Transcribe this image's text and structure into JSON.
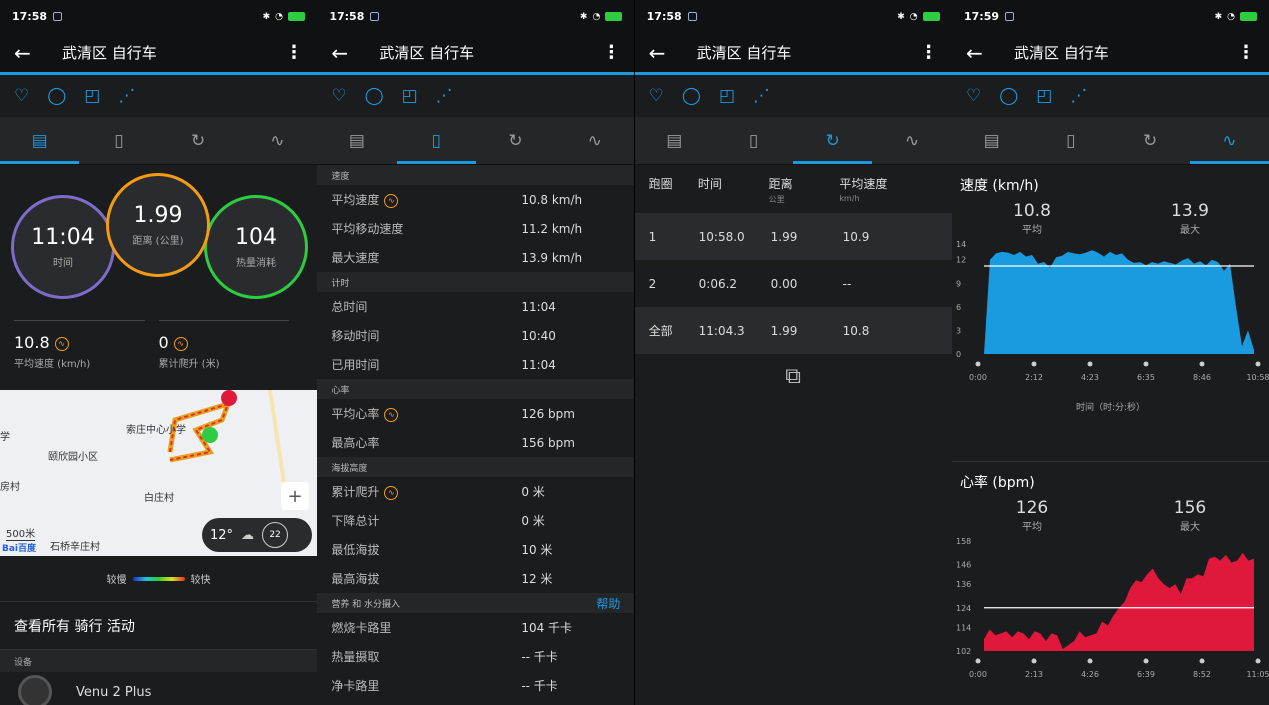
{
  "status_bar": [
    {
      "time": "17:58"
    },
    {
      "time": "17:58"
    },
    {
      "time": "17:58"
    },
    {
      "time": "17:59"
    }
  ],
  "header": {
    "title": "武清区 自行车"
  },
  "panel1": {
    "circles": [
      {
        "value": "11:04",
        "label": "时间"
      },
      {
        "value": "1.99",
        "label": "距离 (公里)"
      },
      {
        "value": "104",
        "label": "热量消耗"
      }
    ],
    "stats": [
      {
        "value": "10.8",
        "label": "平均速度 (km/h)"
      },
      {
        "value": "0",
        "label": "累计爬升 (米)"
      }
    ],
    "map": {
      "places": [
        "学",
        "索庄中心小学",
        "颐欣园小区",
        "白庄村",
        "房村",
        "石桥辛庄村"
      ],
      "scale": "500米",
      "brand": "Bai百度",
      "weather_temp": "12°",
      "wind": "22",
      "zoom": "+"
    },
    "speed_legend": {
      "slow": "较慢",
      "fast": "较快"
    },
    "view_all": "查看所有 骑行 活动",
    "device_section": "设备",
    "device_name": "Venu 2 Plus"
  },
  "panel2": {
    "sections": [
      {
        "title": "速度",
        "rows": [
          {
            "k": "平均速度",
            "v": "10.8 km/h",
            "icon": true
          },
          {
            "k": "平均移动速度",
            "v": "11.2 km/h"
          },
          {
            "k": "最大速度",
            "v": "13.9 km/h"
          }
        ]
      },
      {
        "title": "计时",
        "rows": [
          {
            "k": "总时间",
            "v": "11:04"
          },
          {
            "k": "移动时间",
            "v": "10:40"
          },
          {
            "k": "已用时间",
            "v": "11:04"
          }
        ]
      },
      {
        "title": "心率",
        "rows": [
          {
            "k": "平均心率",
            "v": "126 bpm",
            "icon": true
          },
          {
            "k": "最高心率",
            "v": "156 bpm"
          }
        ]
      },
      {
        "title": "海拔高度",
        "rows": [
          {
            "k": "累计爬升",
            "v": "0 米",
            "icon": true
          },
          {
            "k": "下降总计",
            "v": "0 米"
          },
          {
            "k": "最低海拔",
            "v": "10 米"
          },
          {
            "k": "最高海拔",
            "v": "12 米"
          }
        ]
      },
      {
        "title": "营养 和 水分摄入",
        "help": "帮助",
        "rows": [
          {
            "k": "燃烧卡路里",
            "v": "104 千卡"
          },
          {
            "k": "热量摄取",
            "v": "-- 千卡"
          },
          {
            "k": "净卡路里",
            "v": "-- 千卡"
          }
        ]
      }
    ]
  },
  "panel3": {
    "headers": {
      "lap": "跑圈",
      "time": "时间",
      "dist": "距离",
      "dist_unit": "公里",
      "speed": "平均速度",
      "speed_unit": "km/h"
    },
    "rows": [
      {
        "lap": "1",
        "time": "10:58.0",
        "dist": "1.99",
        "speed": "10.9"
      },
      {
        "lap": "2",
        "time": "0:06.2",
        "dist": "0.00",
        "speed": "--"
      },
      {
        "lap": "全部",
        "time": "11:04.3",
        "dist": "1.99",
        "speed": "10.8"
      }
    ]
  },
  "panel4": {
    "speed": {
      "title": "速度 (km/h)",
      "avg": "10.8",
      "avg_label": "平均",
      "max": "13.9",
      "max_label": "最大",
      "xlabel": "时间（时:分:秒）"
    },
    "hr": {
      "title": "心率 (bpm)",
      "avg": "126",
      "avg_label": "平均",
      "max": "156",
      "max_label": "最大"
    }
  },
  "chart_data": [
    {
      "type": "area",
      "title": "速度 (km/h)",
      "x": [
        "0:00",
        "2:12",
        "4:23",
        "6:35",
        "8:46",
        "10:58"
      ],
      "ylim": [
        0,
        14
      ],
      "yticks": [
        0,
        3,
        6,
        9,
        12,
        14
      ],
      "values": [
        0,
        12,
        12.8,
        13,
        12.9,
        12.6,
        13,
        12.4,
        12.6,
        11.5,
        11.7,
        11,
        12.3,
        12.5,
        13,
        12.8,
        12.7,
        12.9,
        13.2,
        12.9,
        12.4,
        13,
        12.6,
        12.8,
        12,
        11.6,
        11.7,
        11.3,
        11.7,
        11.5,
        11.8,
        11.6,
        11.4,
        11.9,
        12.2,
        11.5,
        11.8,
        11.3,
        12,
        11.7,
        10.6,
        11.5,
        6,
        1,
        3,
        0.5
      ],
      "average": 11.2,
      "color": "#1a9be0"
    },
    {
      "type": "area",
      "title": "心率 (bpm)",
      "x": [
        "0:00",
        "2:13",
        "4:26",
        "6:39",
        "8:52",
        "11:05"
      ],
      "ylim": [
        102,
        158
      ],
      "yticks": [
        102,
        114,
        124,
        136,
        146,
        158
      ],
      "values": [
        108,
        113,
        110,
        111,
        112,
        109,
        112,
        111,
        108,
        112,
        111,
        107,
        111,
        110,
        103,
        105,
        107,
        112,
        109,
        110,
        111,
        117,
        115,
        120,
        124,
        127,
        134,
        138,
        137,
        141,
        144,
        139,
        136,
        134,
        136,
        131,
        139,
        139,
        141,
        140,
        149,
        150,
        148,
        151,
        147,
        148,
        152,
        148,
        149
      ],
      "average": 124,
      "color": "#e0183c"
    }
  ]
}
